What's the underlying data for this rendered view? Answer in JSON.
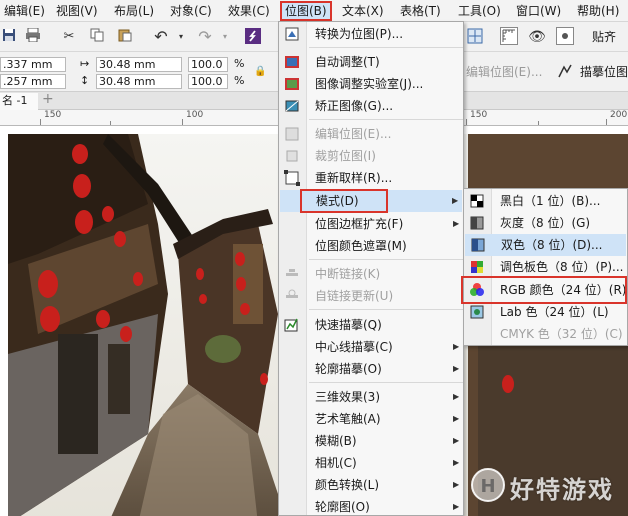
{
  "menubar": {
    "items": [
      {
        "label": "编辑(E)"
      },
      {
        "label": "视图(V)"
      },
      {
        "label": "布局(L)"
      },
      {
        "label": "对象(C)"
      },
      {
        "label": "效果(C)"
      },
      {
        "label": "位图(B)"
      },
      {
        "label": "文本(X)"
      },
      {
        "label": "表格(T)"
      },
      {
        "label": "工具(O)"
      },
      {
        "label": "窗口(W)"
      },
      {
        "label": "帮助(H)"
      }
    ]
  },
  "toolbar": {
    "x_value": ".337 mm",
    "y_value": ".257 mm",
    "width_value": "30.48 mm",
    "height_value": "30.48 mm",
    "scale_x": "100.0",
    "scale_y": "100.0",
    "percent": "%",
    "edit_bitmap": "编辑位图(E)...",
    "trace_bitmap": "描摹位图",
    "paste_label": "贴齐"
  },
  "document": {
    "tab_label": "名 -1"
  },
  "ruler": {
    "labels": [
      "150",
      "100",
      "150",
      "200"
    ]
  },
  "bitmap_menu": {
    "items": [
      {
        "label": "转换为位图(P)...",
        "disabled": false
      },
      {
        "label": "自动调整(T)",
        "disabled": false
      },
      {
        "label": "图像调整实验室(J)...",
        "disabled": false
      },
      {
        "label": "矫正图像(G)...",
        "disabled": false
      },
      {
        "label": "编辑位图(E)...",
        "disabled": true
      },
      {
        "label": "裁剪位图(I)",
        "disabled": true
      },
      {
        "label": "重新取样(R)...",
        "disabled": false
      },
      {
        "label": "模式(D)",
        "disabled": false
      },
      {
        "label": "位图边框扩充(F)",
        "disabled": false
      },
      {
        "label": "位图颜色遮罩(M)",
        "disabled": false
      },
      {
        "label": "中断链接(K)",
        "disabled": true
      },
      {
        "label": "自链接更新(U)",
        "disabled": true
      },
      {
        "label": "快速描摹(Q)",
        "disabled": false
      },
      {
        "label": "中心线描摹(C)",
        "disabled": false
      },
      {
        "label": "轮廓描摹(O)",
        "disabled": false
      },
      {
        "label": "三维效果(3)",
        "disabled": false
      },
      {
        "label": "艺术笔触(A)",
        "disabled": false
      },
      {
        "label": "模糊(B)",
        "disabled": false
      },
      {
        "label": "相机(C)",
        "disabled": false
      },
      {
        "label": "颜色转换(L)",
        "disabled": false
      },
      {
        "label": "轮廓图(O)",
        "disabled": false
      }
    ]
  },
  "mode_submenu": {
    "items": [
      {
        "label": "黑白（1 位）(B)...",
        "disabled": false
      },
      {
        "label": "灰度（8 位）(G)",
        "disabled": false
      },
      {
        "label": "双色（8 位）(D)...",
        "disabled": false
      },
      {
        "label": "调色板色（8 位）(P)...",
        "disabled": false
      },
      {
        "label": "RGB 颜色（24 位）(R)",
        "disabled": false
      },
      {
        "label": "Lab 色（24 位）(L)",
        "disabled": false
      },
      {
        "label": "CMYK 色（32 位）(C)",
        "disabled": true
      }
    ]
  },
  "watermark": {
    "text": "好特游戏"
  },
  "colors": {
    "highlight": "#cfe3f7",
    "annotation_red": "#d9342b",
    "lantern_red": "#c8201c"
  }
}
